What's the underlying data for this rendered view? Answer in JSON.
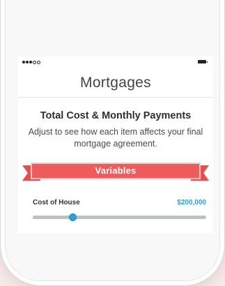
{
  "nav": {
    "title": "Mortgages"
  },
  "status_bar": {
    "signal_icon": "signal-dots-icon",
    "battery_icon": "battery-icon"
  },
  "card": {
    "heading": "Total Cost & Monthly Payments",
    "subtext": "Adjust to see how each item affects your final mortgage agreement."
  },
  "section": {
    "ribbon_label": "Variables",
    "ribbon_color": "#ef5a5a"
  },
  "sliders": [
    {
      "label": "Cost of House",
      "value": "$200,000",
      "position_fraction": 0.23,
      "accent_color": "#2a9fd8"
    }
  ]
}
